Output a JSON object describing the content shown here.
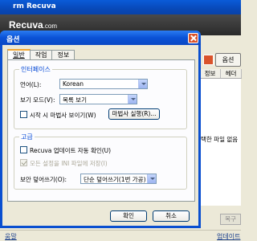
{
  "main": {
    "title": "rm Recuva",
    "brand_name": "Recuva",
    "brand_suffix": ".com",
    "options_button": "옵션",
    "column_headers": [
      "정보",
      "헤더"
    ],
    "message_fragment": "택한 파일 없음",
    "restore_button": "복구",
    "status_left": "움말",
    "status_right": "업데이트"
  },
  "dialog": {
    "title": "옵션",
    "tabs": [
      {
        "label": "일반",
        "active": true
      },
      {
        "label": "작업",
        "active": false
      },
      {
        "label": "정보",
        "active": false
      }
    ],
    "interface_group": {
      "label": "인터페이스",
      "language_label": "언어(L):",
      "language_value": "Korean",
      "view_mode_label": "보기 모드(V):",
      "view_mode_value": "목록 보기",
      "startup_wizard_label": "시작 시 마법사 보이기(W)",
      "startup_wizard_checked": false,
      "run_wizard_button": "마법사 실행(R)..."
    },
    "advanced_group": {
      "label": "고급",
      "auto_update_label": "Recuva 업데이트 자동 확인(U)",
      "auto_update_checked": false,
      "save_ini_label": "모든 설정을 INI 파일에 저장(I)",
      "save_ini_checked": true,
      "save_ini_enabled": false,
      "secure_overwrite_label": "보안 덮어쓰기(O):",
      "secure_overwrite_value": "단순 덮어쓰기(1번 가공)"
    },
    "ok_button": "확인",
    "cancel_button": "취소"
  }
}
